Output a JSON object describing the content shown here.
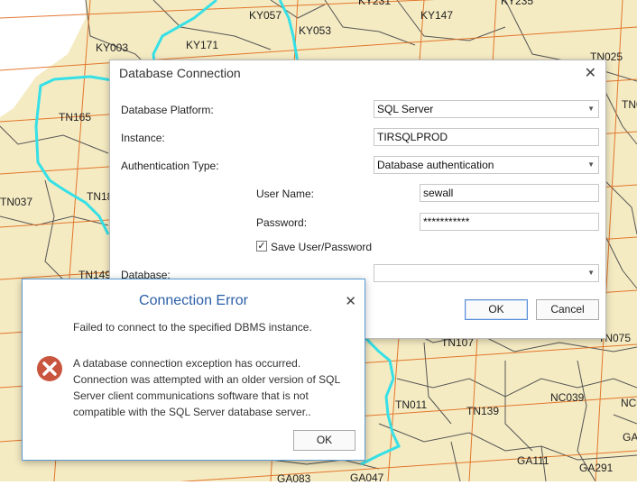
{
  "map": {
    "labels": [
      "KY057",
      "KY231",
      "KY147",
      "KY235",
      "KY003",
      "KY171",
      "KY053",
      "TN025",
      "TN165",
      "TN0",
      "TN037",
      "TN18",
      "TN149",
      "TN107",
      "TN075",
      "TN011",
      "TN139",
      "NC039",
      "NC0",
      "GA111",
      "GA291",
      "GA083",
      "GA047",
      "GA1"
    ]
  },
  "db_connection": {
    "title": "Database Connection",
    "platform_label": "Database Platform:",
    "platform_value": "SQL Server",
    "instance_label": "Instance:",
    "instance_value": "TIRSQLPROD",
    "auth_label": "Authentication Type:",
    "auth_value": "Database authentication",
    "username_label": "User Name:",
    "username_value": "sewall",
    "password_label": "Password:",
    "password_value": "***********",
    "save_label": "Save User/Password",
    "save_checked": true,
    "database_label": "Database:",
    "database_value": "",
    "ok_label": "OK",
    "cancel_label": "Cancel"
  },
  "error_dialog": {
    "title": "Connection Error",
    "message_short": "Failed to connect to the specified DBMS instance.",
    "message_long": "A database connection exception has occurred. Connection was attempted with an older version of SQL Server client communications software that is not compatible with the SQL Server database server..",
    "ok_label": "OK"
  },
  "colors": {
    "map_fill": "#f5ebc3",
    "county_line": "#555555",
    "grid_line": "#e06a1c",
    "state_line": "#35e0e6",
    "error_icon": "#c9553e",
    "error_title": "#2b5fa8"
  }
}
